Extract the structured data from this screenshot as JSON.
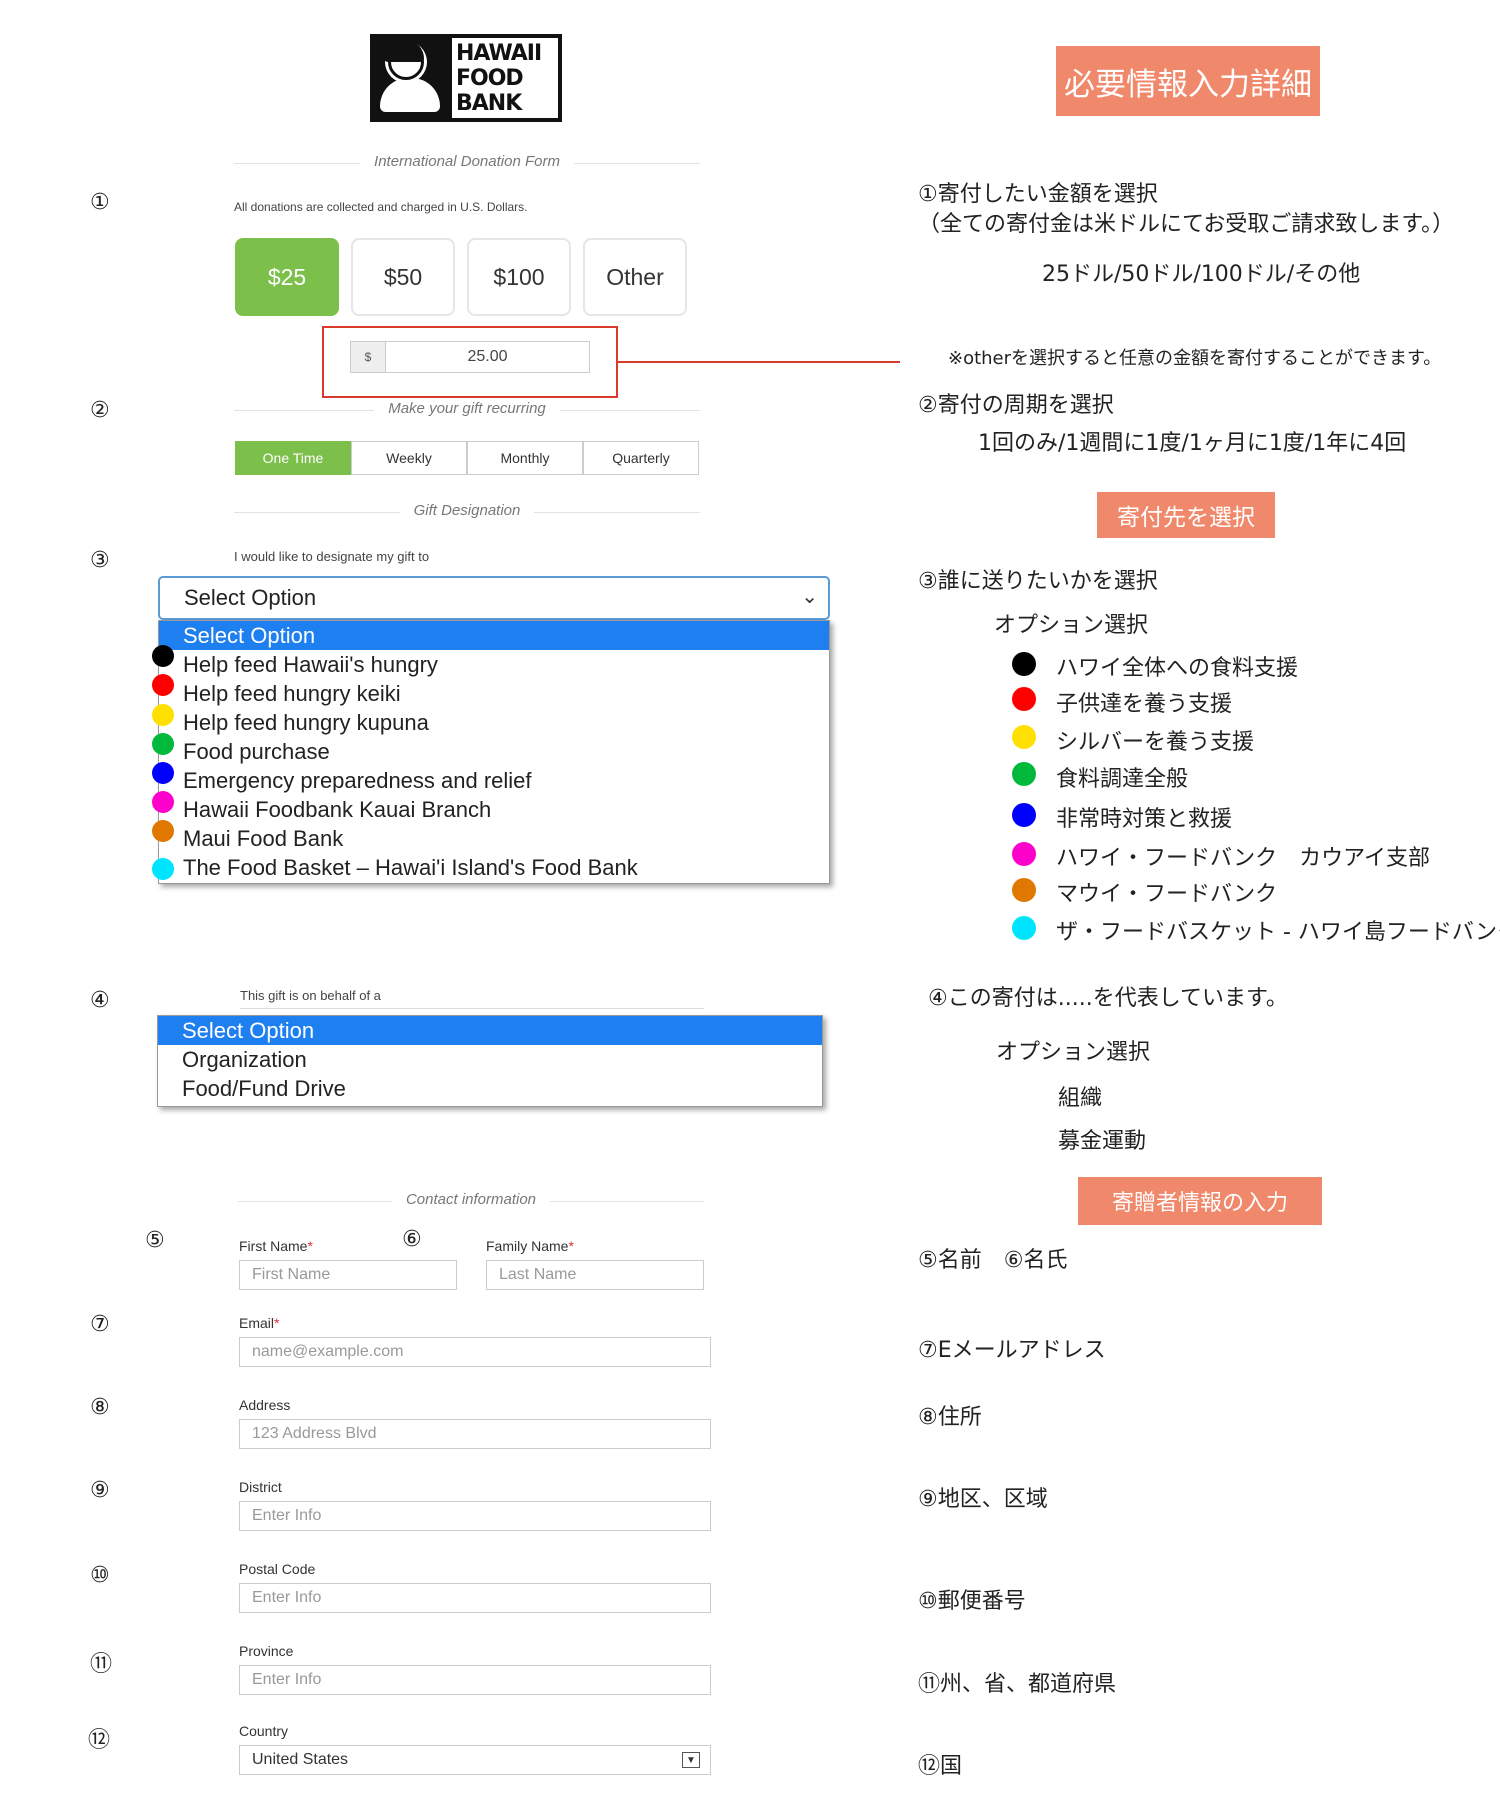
{
  "logo": {
    "line1": "HAWAII",
    "line2": "FOOD",
    "line3": "BANK"
  },
  "form": {
    "section_title": "International Donation Form",
    "dollars_note": "All donations are collected and charged in U.S. Dollars.",
    "amounts": [
      "$25",
      "$50",
      "$100",
      "Other"
    ],
    "amount_prefix": "$",
    "amount_value": "25.00",
    "recurring_title": "Make your gift recurring",
    "frequencies": [
      "One Time",
      "Weekly",
      "Monthly",
      "Quarterly"
    ],
    "designation_title": "Gift Designation",
    "designation_label": "I would like to designate my gift to",
    "designation_selected": "Select Option",
    "designation_options": [
      "Select Option",
      "Help feed Hawaii's hungry",
      "Help feed hungry keiki",
      "Help feed hungry kupuna",
      "Food purchase",
      "Emergency preparedness and relief",
      "Hawaii Foodbank Kauai Branch",
      "Maui Food Bank",
      "The Food Basket – Hawai'i Island's Food Bank"
    ],
    "behalf_label": "This gift is on behalf of a",
    "behalf_options": [
      "Select Option",
      "Organization",
      "Food/Fund Drive"
    ],
    "contact_title": "Contact information",
    "first_name_label": "First Name",
    "first_name_placeholder": "First Name",
    "family_name_label": "Family Name",
    "family_name_placeholder": "Last Name",
    "email_label": "Email",
    "email_placeholder": "name@example.com",
    "address_label": "Address",
    "address_placeholder": "123 Address Blvd",
    "district_label": "District",
    "district_placeholder": "Enter Info",
    "postal_label": "Postal Code",
    "postal_placeholder": "Enter Info",
    "province_label": "Province",
    "province_placeholder": "Enter Info",
    "country_label": "Country",
    "country_value": "United States",
    "required_mark": "*"
  },
  "circle_numbers": [
    "①",
    "②",
    "③",
    "④",
    "⑤",
    "⑥",
    "⑦",
    "⑧",
    "⑨",
    "⑩",
    "⑪",
    "⑫"
  ],
  "option_colors": [
    "#000000",
    "#ff0000",
    "#ffe000",
    "#00b83a",
    "#0000ff",
    "#ff00cc",
    "#e07800",
    "#00e5ff"
  ],
  "accent_color": "#f0896c",
  "explain": {
    "header_badge": "必要情報入力詳細",
    "item1_line1": "①寄付したい金額を選択",
    "item1_line2": "（全ての寄付金は米ドルにてお受取ご請求致します。）",
    "item1_options": "25ドル/50ドル/100ドル/その他",
    "item1_note": "※otherを選択すると任意の金額を寄付することができます。",
    "item2_line1": "②寄付の周期を選択",
    "item2_options": "1回のみ/1週間に1度/1ヶ月に1度/1年に4回",
    "badge_designation": "寄付先を選択",
    "item3_line1": "③誰に送りたいかを選択",
    "option_select": "オプション選択",
    "designation_jp": [
      "ハワイ全体への食料支援",
      "子供達を養う支援",
      "シルバーを養う支援",
      "食料調達全般",
      "非常時対策と救援",
      "ハワイ・フードバンク　カウアイ支部",
      "マウイ・フードバンク",
      "ザ・フードバスケット - ハワイ島フードバンク"
    ],
    "item4_line1": "④この寄付は.....を代表しています。",
    "item4_option_select": "オプション選択",
    "behalf_jp": [
      "組織",
      "募金運動"
    ],
    "badge_contact": "寄贈者情報の入力",
    "item5_6": "⑤名前　⑥名氏",
    "item7": "⑦Eメールアドレス",
    "item8": "⑧住所",
    "item9": "⑨地区、区域",
    "item10": "⑩郵便番号",
    "item11": "⑪州、省、都道府県",
    "item12": "⑫国"
  }
}
